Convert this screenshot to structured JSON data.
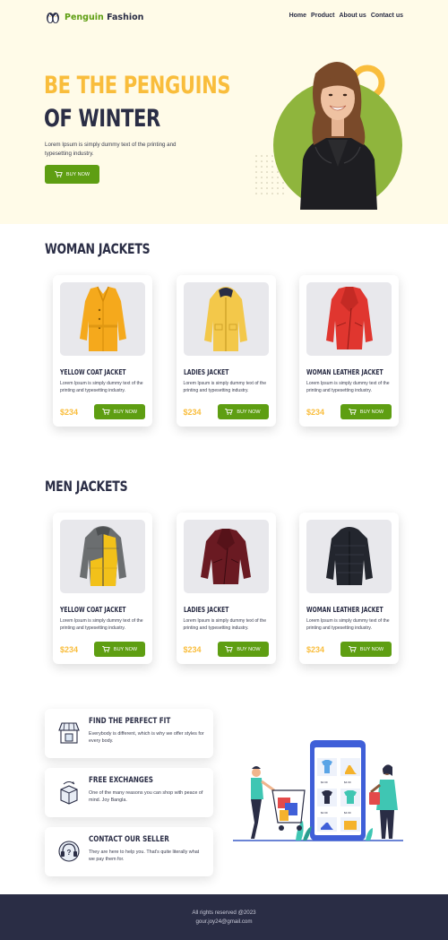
{
  "brand": {
    "name_part1": "Penguin",
    "name_part2": " Fashion"
  },
  "nav": {
    "items": [
      "Home",
      "Product",
      "About us",
      "Contact us"
    ]
  },
  "hero": {
    "title_line1": "BE THE PENGUINS",
    "title_line2": "OF WINTER",
    "description": "Lorem Ipsum is simply dummy text of the printing and typesetting industry.",
    "button_label": "BUY NOW"
  },
  "sections": {
    "women": {
      "title": "WOMAN JACKETS",
      "products": [
        {
          "name": "YELLOW COAT JACKET",
          "description": "Lorem Ipsum is simply dummy text of the printing and typesetting industry.",
          "price": "$234",
          "button": "BUY NOW",
          "image": "yellow-coat-icon"
        },
        {
          "name": "LADIES JACKET",
          "description": "Lorem Ipsum is simply dummy text of the printing and typesetting industry.",
          "price": "$234",
          "button": "BUY NOW",
          "image": "ladies-jacket-icon"
        },
        {
          "name": "WOMAN LEATHER JACKET",
          "description": "Lorem Ipsum is simply dummy text of the printing and typesetting industry.",
          "price": "$234",
          "button": "BUY NOW",
          "image": "red-leather-jacket-icon"
        }
      ]
    },
    "men": {
      "title": "MEN JACKETS",
      "products": [
        {
          "name": "YELLOW COAT JACKET",
          "description": "Lorem Ipsum is simply dummy text of the printing and typesetting industry.",
          "price": "$234",
          "button": "BUY NOW",
          "image": "puffer-jacket-icon"
        },
        {
          "name": "LADIES JACKET",
          "description": "Lorem Ipsum is simply dummy text of the printing and typesetting industry.",
          "price": "$234",
          "button": "BUY NOW",
          "image": "maroon-leather-jacket-icon"
        },
        {
          "name": "WOMAN LEATHER JACKET",
          "description": "Lorem Ipsum is simply dummy text of the printing and typesetting industry.",
          "price": "$234",
          "button": "BUY NOW",
          "image": "black-puffer-jacket-icon"
        }
      ]
    }
  },
  "features": [
    {
      "title": "FIND THE PERFECT FIT",
      "description": "Everybody is different, which is why we offer styles for every body.",
      "icon": "shop-icon"
    },
    {
      "title": "FREE EXCHANGES",
      "description": "One of the many reasons you can shop with peace of mind. Joy Bangla.",
      "icon": "box-exchange-icon"
    },
    {
      "title": "CONTACT OUR SELLER",
      "description": "They are here to help you. That's quite literally what we pay them for.",
      "icon": "support-headset-icon"
    }
  ],
  "footer": {
    "copyright": "All rights reserved @2023",
    "email": "gour.joy24@gmail.com"
  },
  "colors": {
    "accent_green": "#5e9e12",
    "accent_yellow": "#f9bd3c",
    "navy": "#2a2d45",
    "hero_bg": "#fffbe8"
  }
}
